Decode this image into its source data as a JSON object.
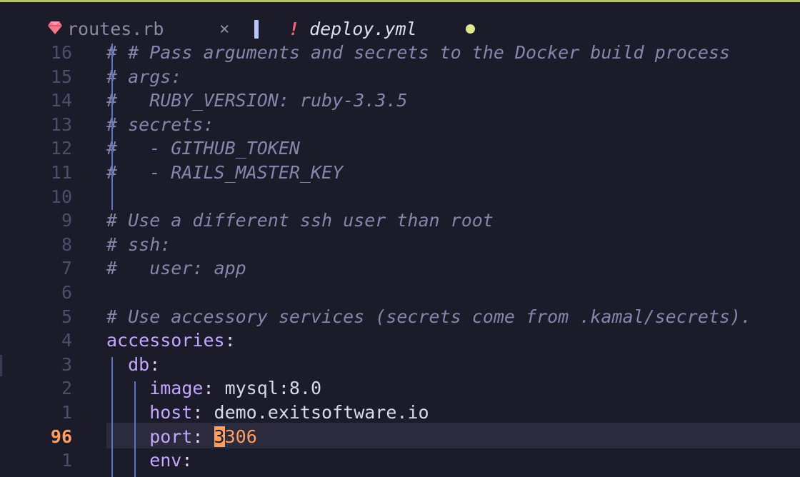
{
  "tabs": [
    {
      "label": "routes.rb",
      "icon": "ruby-icon",
      "close": "×"
    },
    {
      "label": "deploy.yml",
      "marker": "!",
      "modified_dot": true
    }
  ],
  "colors": {
    "accent": "#b8c4ff",
    "current_line_number": "#ff9e64",
    "comment": "#8884ac",
    "key": "#c3a6ff"
  },
  "lines": [
    {
      "num": "16",
      "segments": [
        {
          "t": "# # Pass arguments and secrets to the Docker build process",
          "c": "cmt"
        }
      ]
    },
    {
      "num": "15",
      "segments": [
        {
          "t": "# args:",
          "c": "cmt"
        }
      ]
    },
    {
      "num": "14",
      "segments": [
        {
          "t": "#   RUBY_VERSION: ruby-3.3.5",
          "c": "cmt"
        }
      ]
    },
    {
      "num": "13",
      "segments": [
        {
          "t": "# secrets:",
          "c": "cmt"
        }
      ]
    },
    {
      "num": "12",
      "segments": [
        {
          "t": "#   - GITHUB_TOKEN",
          "c": "cmt"
        }
      ]
    },
    {
      "num": "11",
      "segments": [
        {
          "t": "#   - RAILS_MASTER_KEY",
          "c": "cmt"
        }
      ]
    },
    {
      "num": "10",
      "segments": []
    },
    {
      "num": "9",
      "segments": [
        {
          "t": "# Use a different ssh user than root",
          "c": "cmt"
        }
      ]
    },
    {
      "num": "8",
      "segments": [
        {
          "t": "# ssh:",
          "c": "cmt"
        }
      ]
    },
    {
      "num": "7",
      "segments": [
        {
          "t": "#   user: app",
          "c": "cmt"
        }
      ]
    },
    {
      "num": "6",
      "segments": []
    },
    {
      "num": "5",
      "segments": [
        {
          "t": "# Use accessory services (secrets come from .kamal/secrets).",
          "c": "cmt"
        }
      ]
    },
    {
      "num": "4",
      "segments": [
        {
          "t": "accessories",
          "c": "key"
        },
        {
          "t": ":",
          "c": "val"
        }
      ]
    },
    {
      "num": "3",
      "segments": [
        {
          "t": "  db",
          "c": "key"
        },
        {
          "t": ":",
          "c": "val"
        }
      ]
    },
    {
      "num": "2",
      "segments": [
        {
          "t": "    image",
          "c": "key"
        },
        {
          "t": ": mysql:8.0",
          "c": "val"
        }
      ]
    },
    {
      "num": "1",
      "segments": [
        {
          "t": "    host",
          "c": "key"
        },
        {
          "t": ": demo.exitsoftware.io",
          "c": "val"
        }
      ]
    },
    {
      "num": "96",
      "current": true,
      "segments": [
        {
          "t": "    port",
          "c": "key"
        },
        {
          "t": ": ",
          "c": "val"
        },
        {
          "t": "3",
          "c": "cursor-char"
        },
        {
          "t": "306",
          "c": "num"
        }
      ]
    },
    {
      "num": "1",
      "segments": [
        {
          "t": "    env",
          "c": "key"
        },
        {
          "t": ":",
          "c": "val"
        }
      ]
    }
  ]
}
